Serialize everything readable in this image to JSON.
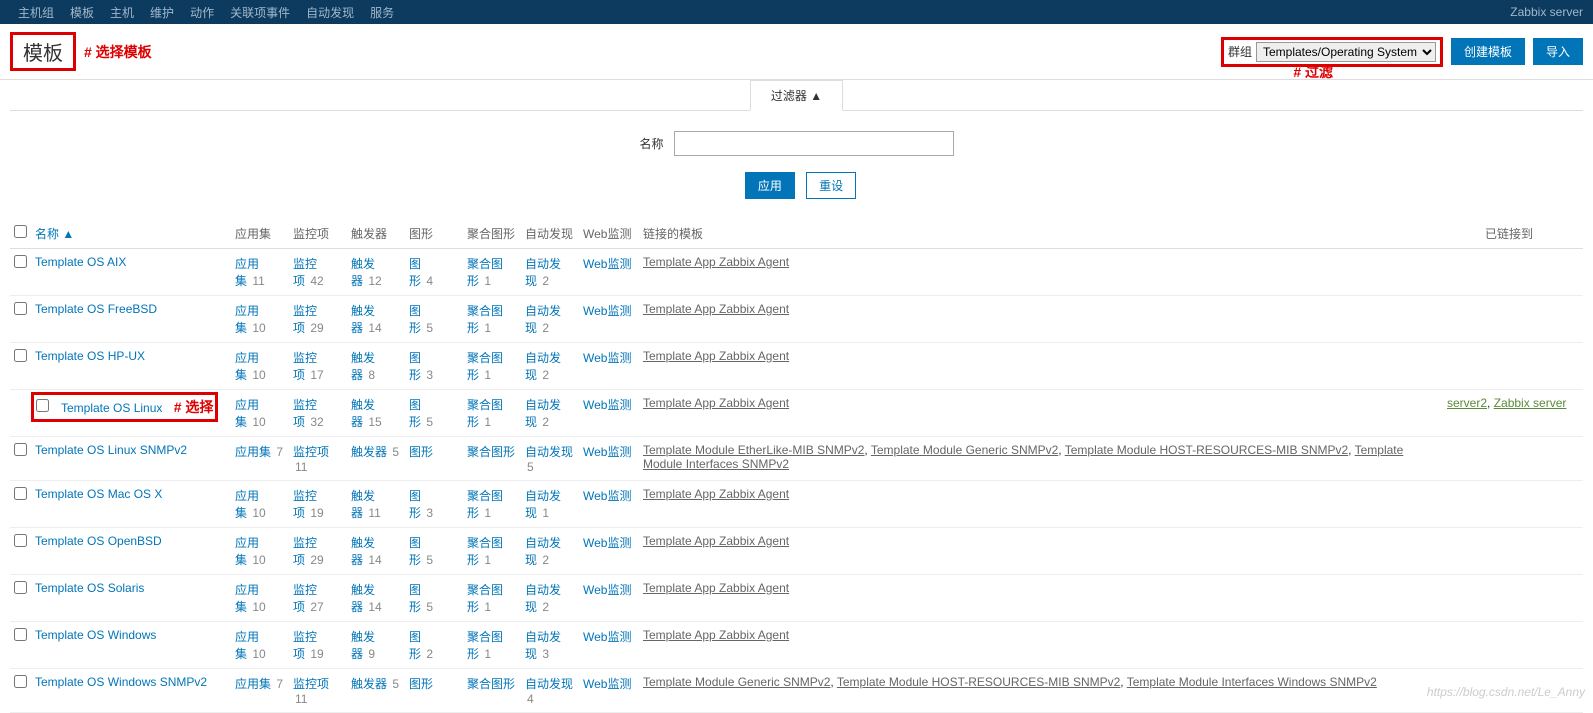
{
  "nav": {
    "items": [
      "主机组",
      "模板",
      "主机",
      "维护",
      "动作",
      "关联项事件",
      "自动发现",
      "服务"
    ],
    "right": "Zabbix server"
  },
  "page": {
    "title": "模板",
    "anno_select_template": "# 选择模板",
    "anno_filter": "# 过滤",
    "anno_select": "# 选择",
    "group_label": "群组",
    "group_value": "Templates/Operating Systems",
    "btn_create": "创建模板",
    "btn_import": "导入"
  },
  "filter": {
    "tab": "过滤器 ▲",
    "name_label": "名称",
    "name_value": "",
    "apply": "应用",
    "reset": "重设"
  },
  "cols": {
    "name": "名称 ▲",
    "apps": "应用集",
    "items": "监控项",
    "triggers": "触发器",
    "graphs": "图形",
    "screens": "聚合图形",
    "discovery": "自动发现",
    "web": "Web监测",
    "linked": "链接的模板",
    "linkedto": "已链接到"
  },
  "labels": {
    "apps": "应用集",
    "items": "监控项",
    "triggers": "触发器",
    "graphs": "图形",
    "screens": "聚合图形",
    "discovery": "自动发现",
    "web": "Web监测"
  },
  "rows": [
    {
      "name": "Template OS AIX",
      "apps": "11",
      "items": "42",
      "triggers": "12",
      "graphs": "4",
      "screens": "1",
      "discovery": "2",
      "linked": [
        {
          "t": "Template App Zabbix Agent"
        }
      ],
      "to": []
    },
    {
      "name": "Template OS FreeBSD",
      "apps": "10",
      "items": "29",
      "triggers": "14",
      "graphs": "5",
      "screens": "1",
      "discovery": "2",
      "linked": [
        {
          "t": "Template App Zabbix Agent"
        }
      ],
      "to": []
    },
    {
      "name": "Template OS HP-UX",
      "apps": "10",
      "items": "17",
      "triggers": "8",
      "graphs": "3",
      "screens": "1",
      "discovery": "2",
      "linked": [
        {
          "t": "Template App Zabbix Agent"
        }
      ],
      "to": []
    },
    {
      "name": "Template OS Linux",
      "apps": "10",
      "items": "32",
      "triggers": "15",
      "graphs": "5",
      "screens": "1",
      "discovery": "2",
      "linked": [
        {
          "t": "Template App Zabbix Agent"
        }
      ],
      "to": [
        {
          "t": "server2"
        },
        {
          "t": "Zabbix server"
        }
      ],
      "hl": true
    },
    {
      "name": "Template OS Linux SNMPv2",
      "apps": "7",
      "items": "11",
      "triggers": "5",
      "graphs": "",
      "screens": "",
      "discovery": "5",
      "single": true,
      "linked": [
        {
          "t": "Template Module EtherLike-MIB SNMPv2"
        },
        {
          "t": "Template Module Generic SNMPv2"
        },
        {
          "t": "Template Module HOST-RESOURCES-MIB SNMPv2"
        },
        {
          "t": "Template Module Interfaces SNMPv2"
        }
      ],
      "to": []
    },
    {
      "name": "Template OS Mac OS X",
      "apps": "10",
      "items": "19",
      "triggers": "11",
      "graphs": "3",
      "screens": "1",
      "discovery": "1",
      "linked": [
        {
          "t": "Template App Zabbix Agent"
        }
      ],
      "to": []
    },
    {
      "name": "Template OS OpenBSD",
      "apps": "10",
      "items": "29",
      "triggers": "14",
      "graphs": "5",
      "screens": "1",
      "discovery": "2",
      "linked": [
        {
          "t": "Template App Zabbix Agent"
        }
      ],
      "to": []
    },
    {
      "name": "Template OS Solaris",
      "apps": "10",
      "items": "27",
      "triggers": "14",
      "graphs": "5",
      "screens": "1",
      "discovery": "2",
      "linked": [
        {
          "t": "Template App Zabbix Agent"
        }
      ],
      "to": []
    },
    {
      "name": "Template OS Windows",
      "apps": "10",
      "items": "19",
      "triggers": "9",
      "graphs": "2",
      "screens": "1",
      "discovery": "3",
      "linked": [
        {
          "t": "Template App Zabbix Agent"
        }
      ],
      "to": []
    },
    {
      "name": "Template OS Windows SNMPv2",
      "apps": "7",
      "items": "11",
      "triggers": "5",
      "graphs": "",
      "screens": "",
      "discovery": "4",
      "single": true,
      "linked": [
        {
          "t": "Template Module Generic SNMPv2"
        },
        {
          "t": "Template Module HOST-RESOURCES-MIB SNMPv2"
        },
        {
          "t": "Template Module Interfaces Windows SNMPv2"
        }
      ],
      "to": []
    }
  ],
  "watermark": "https://blog.csdn.net/Le_Anny"
}
